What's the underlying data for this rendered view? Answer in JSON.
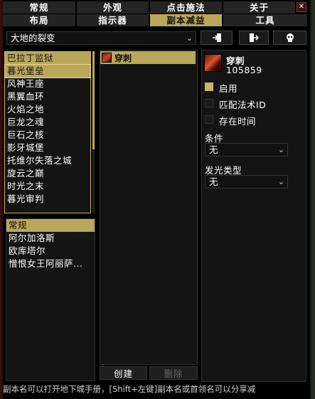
{
  "tabs_row1": [
    {
      "label": "常规"
    },
    {
      "label": "外观"
    },
    {
      "label": "点击施法"
    },
    {
      "label": "关于"
    }
  ],
  "tabs_row2": [
    {
      "label": "布局"
    },
    {
      "label": "指示器"
    },
    {
      "label": "副本减益"
    },
    {
      "label": "工具"
    }
  ],
  "close_label": "✕",
  "expansion_dropdown": {
    "value": "大地的裂变"
  },
  "toolbar_icons": [
    "import-icon",
    "export-icon",
    "reset-skull-icon"
  ],
  "instances": [
    "巴拉丁监狱",
    "暮光堡垒",
    "风神王座",
    "黑翼血环",
    "火焰之地",
    "巨龙之魂",
    "巨石之核",
    "影牙城堡",
    "托维尔失落之城",
    "旋云之巅",
    "时光之末",
    "暮光审判"
  ],
  "selected_instance": "暮光堡垒",
  "bosses": [
    "常规",
    "阿尔加洛斯",
    "欧库塔尔",
    "憎恨女王阿丽萨..."
  ],
  "auras": [
    {
      "name": "穿刺"
    }
  ],
  "detail": {
    "spell_name": "穿刺",
    "spell_id": "105859",
    "enabled_label": "启用",
    "enabled_checked": true,
    "match_spell_id_label": "匹配法术ID",
    "match_spell_id_checked": false,
    "duration_label": "存在时间",
    "duration_checked": false,
    "condition_label": "条件",
    "condition_value": "无",
    "glow_label": "发光类型",
    "glow_value": "无"
  },
  "buttons": {
    "create": "创建",
    "delete": "删除"
  },
  "footer_text": "副本名可以打开地下城手册，[Shift+左键]副本名或首领名可以分享减"
}
